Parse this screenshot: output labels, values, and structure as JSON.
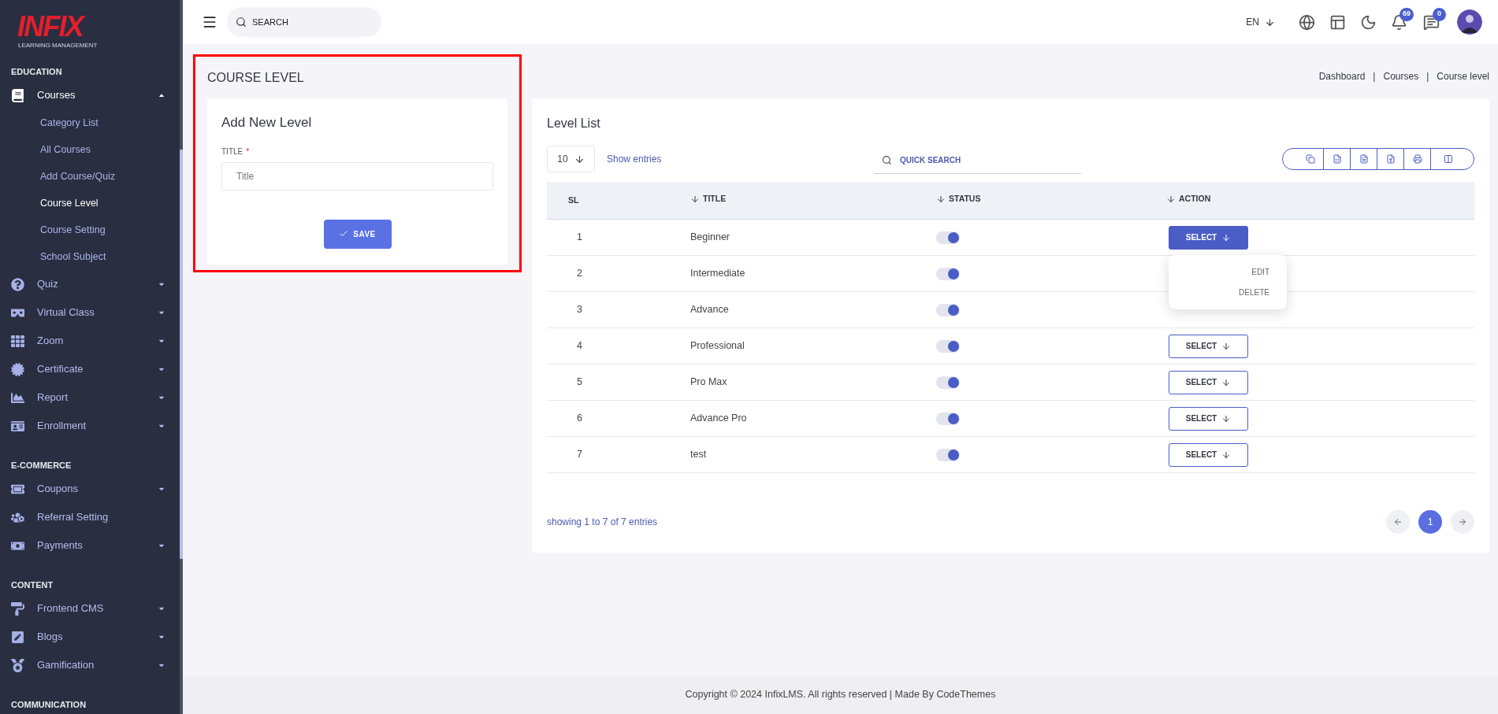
{
  "logo": {
    "brand": "INFIX",
    "tagline": "LEARNING MANAGEMENT"
  },
  "sidebar": {
    "sections": [
      {
        "heading": "EDUCATION",
        "items": [
          {
            "label": "Courses",
            "expanded": true,
            "children": [
              {
                "label": "Category List",
                "selected": false
              },
              {
                "label": "All Courses",
                "selected": false
              },
              {
                "label": "Add Course/Quiz",
                "selected": false
              },
              {
                "label": "Course Level",
                "selected": true
              },
              {
                "label": "Course Setting",
                "selected": false
              },
              {
                "label": "School Subject",
                "selected": false
              }
            ]
          },
          {
            "label": "Quiz",
            "expanded": false
          },
          {
            "label": "Virtual Class",
            "expanded": false
          },
          {
            "label": "Zoom",
            "expanded": false
          },
          {
            "label": "Certificate",
            "expanded": false
          },
          {
            "label": "Report",
            "expanded": false
          },
          {
            "label": "Enrollment",
            "expanded": false
          }
        ]
      },
      {
        "heading": "E-COMMERCE",
        "items": [
          {
            "label": "Coupons",
            "expanded": false
          },
          {
            "label": "Referral Setting"
          },
          {
            "label": "Payments",
            "expanded": false
          }
        ]
      },
      {
        "heading": "CONTENT",
        "items": [
          {
            "label": "Frontend CMS",
            "expanded": false
          },
          {
            "label": "Blogs",
            "expanded": false
          },
          {
            "label": "Gamification",
            "expanded": false
          }
        ]
      },
      {
        "heading": "COMMUNICATION"
      }
    ]
  },
  "header": {
    "search": {
      "placeholder": "SEARCH"
    },
    "language": "EN",
    "notifications": "69",
    "messages": "0"
  },
  "page": {
    "title": "COURSE LEVEL",
    "highlighted": true,
    "breadcrumb": [
      "Dashboard",
      "|",
      "Courses",
      "|",
      "Course level"
    ]
  },
  "form": {
    "title": "Add New Level",
    "field_label": "TITLE",
    "required_mark": "*",
    "placeholder": "Title",
    "button": "SAVE"
  },
  "list": {
    "title": "Level List",
    "page_size": "10",
    "show_entries": "Show entries",
    "search": {
      "placeholder": "QUICK SEARCH"
    },
    "columns": [
      {
        "label": "SL",
        "sortable": false
      },
      {
        "label": "TITLE",
        "sortable": true
      },
      {
        "label": "STATUS",
        "sortable": true
      },
      {
        "label": "ACTION",
        "sortable": true
      }
    ],
    "rows": [
      {
        "sl": "1",
        "title": "Beginner",
        "on": true,
        "action": {
          "label": "SELECT",
          "open": true,
          "menu": [
            "EDIT",
            "DELETE"
          ]
        }
      },
      {
        "sl": "2",
        "title": "Intermediate",
        "on": true
      },
      {
        "sl": "3",
        "title": "Advance",
        "on": true
      },
      {
        "sl": "4",
        "title": "Professional",
        "on": true,
        "action": {
          "label": "SELECT",
          "open": false
        }
      },
      {
        "sl": "5",
        "title": "Pro Max",
        "on": true,
        "action": {
          "label": "SELECT",
          "open": false
        }
      },
      {
        "sl": "6",
        "title": "Advance Pro",
        "on": true,
        "action": {
          "label": "SELECT",
          "open": false
        }
      },
      {
        "sl": "7",
        "title": "test",
        "on": true,
        "action": {
          "label": "SELECT",
          "open": false
        }
      }
    ],
    "summary": "showing 1 to 7 of 7 entries",
    "pages": [
      {
        "label": "1",
        "selected": true
      }
    ]
  },
  "footer": "Copyright © 2024 InfixLMS. All rights reserved | Made By CodeThemes"
}
